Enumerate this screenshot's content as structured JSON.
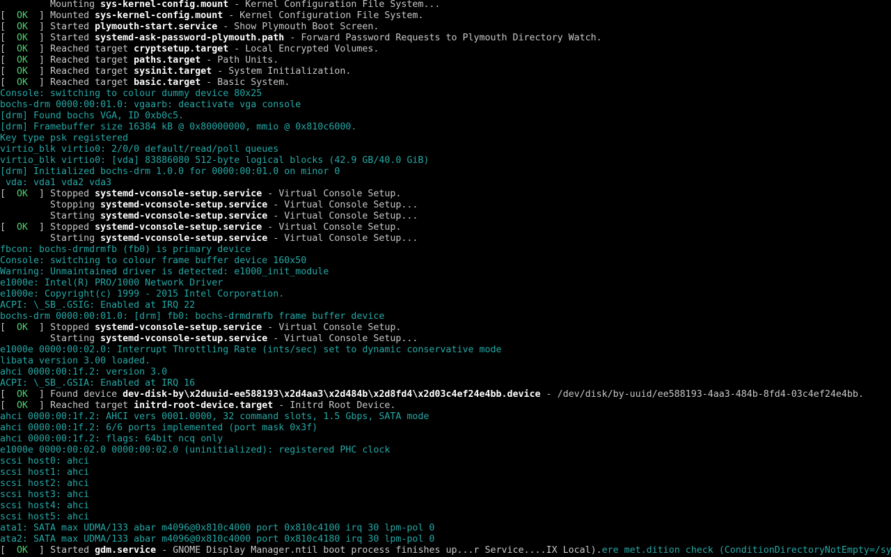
{
  "screen": {
    "kind": "boot-console",
    "colors": {
      "background": "#000000",
      "default_text": "#c8c8c8",
      "bold_text": "#ffffff",
      "kernel_text": "#25a8a6",
      "ok_status": "#52d273"
    }
  },
  "console": {
    "lines": [
      [
        [
          "w",
          "         Mounting "
        ],
        [
          "b",
          "sys-kernel-config.mount"
        ],
        [
          "w",
          " - Kernel Configuration File System..."
        ]
      ],
      [
        [
          "w",
          "[  "
        ],
        [
          "ok",
          "OK"
        ],
        [
          "w",
          "  ] Mounted "
        ],
        [
          "b",
          "sys-kernel-config.mount"
        ],
        [
          "w",
          " - Kernel Configuration File System."
        ]
      ],
      [
        [
          "w",
          "[  "
        ],
        [
          "ok",
          "OK"
        ],
        [
          "w",
          "  ] Started "
        ],
        [
          "b",
          "plymouth-start.service"
        ],
        [
          "w",
          " - Show Plymouth Boot Screen."
        ]
      ],
      [
        [
          "w",
          "[  "
        ],
        [
          "ok",
          "OK"
        ],
        [
          "w",
          "  ] Started "
        ],
        [
          "b",
          "systemd-ask-password-plymouth.path"
        ],
        [
          "w",
          " - Forward Password Requests to Plymouth Directory Watch."
        ]
      ],
      [
        [
          "w",
          "[  "
        ],
        [
          "ok",
          "OK"
        ],
        [
          "w",
          "  ] Reached target "
        ],
        [
          "b",
          "cryptsetup.target"
        ],
        [
          "w",
          " - Local Encrypted Volumes."
        ]
      ],
      [
        [
          "w",
          "[  "
        ],
        [
          "ok",
          "OK"
        ],
        [
          "w",
          "  ] Reached target "
        ],
        [
          "b",
          "paths.target"
        ],
        [
          "w",
          " - Path Units."
        ]
      ],
      [
        [
          "w",
          "[  "
        ],
        [
          "ok",
          "OK"
        ],
        [
          "w",
          "  ] Reached target "
        ],
        [
          "b",
          "sysinit.target"
        ],
        [
          "w",
          " - System Initialization."
        ]
      ],
      [
        [
          "w",
          "[  "
        ],
        [
          "ok",
          "OK"
        ],
        [
          "w",
          "  ] Reached target "
        ],
        [
          "b",
          "basic.target"
        ],
        [
          "w",
          " - Basic System."
        ]
      ],
      [
        [
          "c",
          "Console: switching to colour dummy device 80x25"
        ]
      ],
      [
        [
          "c",
          "bochs-drm 0000:00:01.0: vgaarb: deactivate vga console"
        ]
      ],
      [
        [
          "c",
          "[drm] Found bochs VGA, ID 0xb0c5."
        ]
      ],
      [
        [
          "c",
          "[drm] Framebuffer size 16384 kB @ 0x80000000, mmio @ 0x810c6000."
        ]
      ],
      [
        [
          "c",
          "Key type psk registered"
        ]
      ],
      [
        [
          "c",
          "virtio_blk virtio0: 2/0/0 default/read/poll queues"
        ]
      ],
      [
        [
          "c",
          "virtio_blk virtio0: [vda] 83886080 512-byte logical blocks (42.9 GB/40.0 GiB)"
        ]
      ],
      [
        [
          "c",
          "[drm] Initialized bochs-drm 1.0.0 for 0000:00:01.0 on minor 0"
        ]
      ],
      [
        [
          "c",
          " vda: vda1 vda2 vda3"
        ]
      ],
      [
        [
          "w",
          "[  "
        ],
        [
          "ok",
          "OK"
        ],
        [
          "w",
          "  ] Stopped "
        ],
        [
          "b",
          "systemd-vconsole-setup.service"
        ],
        [
          "w",
          " - Virtual Console Setup."
        ]
      ],
      [
        [
          "w",
          "         Stopping "
        ],
        [
          "b",
          "systemd-vconsole-setup.service"
        ],
        [
          "w",
          " - Virtual Console Setup..."
        ]
      ],
      [
        [
          "w",
          "         Starting "
        ],
        [
          "b",
          "systemd-vconsole-setup.service"
        ],
        [
          "w",
          " - Virtual Console Setup..."
        ]
      ],
      [
        [
          "w",
          "[  "
        ],
        [
          "ok",
          "OK"
        ],
        [
          "w",
          "  ] Stopped "
        ],
        [
          "b",
          "systemd-vconsole-setup.service"
        ],
        [
          "w",
          " - Virtual Console Setup."
        ]
      ],
      [
        [
          "w",
          "         Starting "
        ],
        [
          "b",
          "systemd-vconsole-setup.service"
        ],
        [
          "w",
          " - Virtual Console Setup..."
        ]
      ],
      [
        [
          "c",
          "fbcon: bochs-drmdrmfb (fb0) is primary device"
        ]
      ],
      [
        [
          "c",
          "Console: switching to colour frame buffer device 160x50"
        ]
      ],
      [
        [
          "c",
          "Warning: Unmaintained driver is detected: e1000_init_module"
        ]
      ],
      [
        [
          "c",
          "e1000e: Intel(R) PRO/1000 Network Driver"
        ]
      ],
      [
        [
          "c",
          "e1000e: Copyright(c) 1999 - 2015 Intel Corporation."
        ]
      ],
      [
        [
          "c",
          "ACPI: \\_SB_.GSIG: Enabled at IRQ 22"
        ]
      ],
      [
        [
          "c",
          "bochs-drm 0000:00:01.0: [drm] fb0: bochs-drmdrmfb frame buffer device"
        ]
      ],
      [
        [
          "w",
          "[  "
        ],
        [
          "ok",
          "OK"
        ],
        [
          "w",
          "  ] Stopped "
        ],
        [
          "b",
          "systemd-vconsole-setup.service"
        ],
        [
          "w",
          " - Virtual Console Setup."
        ]
      ],
      [
        [
          "w",
          "         Starting "
        ],
        [
          "b",
          "systemd-vconsole-setup.service"
        ],
        [
          "w",
          " - Virtual Console Setup..."
        ]
      ],
      [
        [
          "c",
          "e1000e 0000:00:02.0: Interrupt Throttling Rate (ints/sec) set to dynamic conservative mode"
        ]
      ],
      [
        [
          "c",
          "libata version 3.00 loaded."
        ]
      ],
      [
        [
          "c",
          "ahci 0000:00:1f.2: version 3.0"
        ]
      ],
      [
        [
          "c",
          "ACPI: \\_SB_.GSIA: Enabled at IRQ 16"
        ]
      ],
      [
        [
          "w",
          "[  "
        ],
        [
          "ok",
          "OK"
        ],
        [
          "w",
          "  ] Found device "
        ],
        [
          "b",
          "dev-disk-by\\x2duuid-ee588193\\x2d4aa3\\x2d484b\\x2d8fd4\\x2d03c4ef24e4bb.device"
        ],
        [
          "w",
          " - /dev/disk/by-uuid/ee588193-4aa3-484b-8fd4-03c4ef24e4bb."
        ]
      ],
      [
        [
          "w",
          "[  "
        ],
        [
          "ok",
          "OK"
        ],
        [
          "w",
          "  ] Reached target "
        ],
        [
          "b",
          "initrd-root-device.target"
        ],
        [
          "w",
          " - Initrd Root Device."
        ]
      ],
      [
        [
          "c",
          "ahci 0000:00:1f.2: AHCI vers 0001.0000, 32 command slots, 1.5 Gbps, SATA mode"
        ]
      ],
      [
        [
          "c",
          "ahci 0000:00:1f.2: 6/6 ports implemented (port mask 0x3f)"
        ]
      ],
      [
        [
          "c",
          "ahci 0000:00:1f.2: flags: 64bit ncq only"
        ]
      ],
      [
        [
          "c",
          "e1000e 0000:00:02.0 0000:00:02.0 (uninitialized): registered PHC clock"
        ]
      ],
      [
        [
          "c",
          "scsi host0: ahci"
        ]
      ],
      [
        [
          "c",
          "scsi host1: ahci"
        ]
      ],
      [
        [
          "c",
          "scsi host2: ahci"
        ]
      ],
      [
        [
          "c",
          "scsi host3: ahci"
        ]
      ],
      [
        [
          "c",
          "scsi host4: ahci"
        ]
      ],
      [
        [
          "c",
          "scsi host5: ahci"
        ]
      ],
      [
        [
          "c",
          "ata1: SATA max UDMA/133 abar m4096@0x810c4000 port 0x810c4100 irq 30 lpm-pol 0"
        ]
      ],
      [
        [
          "c",
          "ata2: SATA max UDMA/133 abar m4096@0x810c4000 port 0x810c4180 irq 30 lpm-pol 0"
        ]
      ],
      [
        [
          "w",
          "[  "
        ],
        [
          "ok",
          "OK"
        ],
        [
          "w",
          "  ] Started "
        ],
        [
          "b",
          "gdm.service"
        ],
        [
          "w",
          " - GNOME Display Manager.ntil boot process finishes up...r Service....IX Local)."
        ],
        [
          "c",
          "ere met.dition check (ConditionDirectoryNotEmpty=/sy"
        ]
      ]
    ]
  }
}
